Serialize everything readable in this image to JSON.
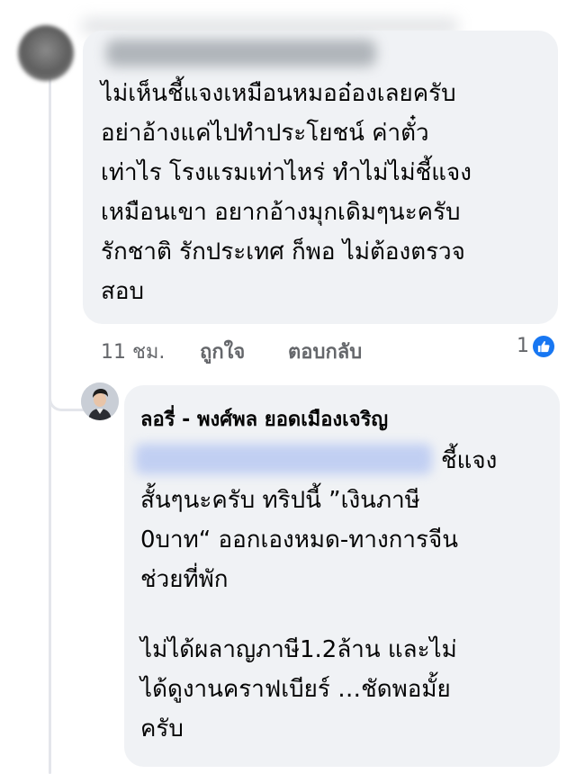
{
  "comment": {
    "lines": [
      "ไม่เห็นชี้แจงเหมือนหมออ๋องเลยครับ",
      "อย่าอ้างแค่ไปทำประโยชน์ ค่าตั๋ว",
      "เท่าไร โรงแรมเท่าไหร่ ทำไม่ไม่ชี้แจง",
      "เหมือนเขา อยากอ้างมุกเดิมๆนะครับ",
      "รักชาติ รักประเทศ ก็พอ ไม่ต้องตรวจ",
      "สอบ"
    ],
    "time": "11 ชม.",
    "like_label": "ถูกใจ",
    "reply_label": "ตอบกลับ",
    "reaction_count": "1",
    "reaction_icon": "thumbs-up-icon",
    "reaction_color": "#1877f2"
  },
  "reply": {
    "author": "ลอรี่ - พงศ์พล ยอดเมืองเจริญ",
    "first_line_end": "ชี้แจง",
    "lines": [
      "สั้นๆนะครับ ทริปนี้ ”เงินภาษี",
      "0บาท“ ออกเองหมด-ทางการจีน",
      "ช่วยที่พัก"
    ],
    "lines2": [
      "ไม่ได้ผลาญภาษี1.2ล้าน  และไม่",
      "ได้ดูงานคราฟเบียร์ …ชัดพอมั้ย",
      "ครับ"
    ]
  }
}
